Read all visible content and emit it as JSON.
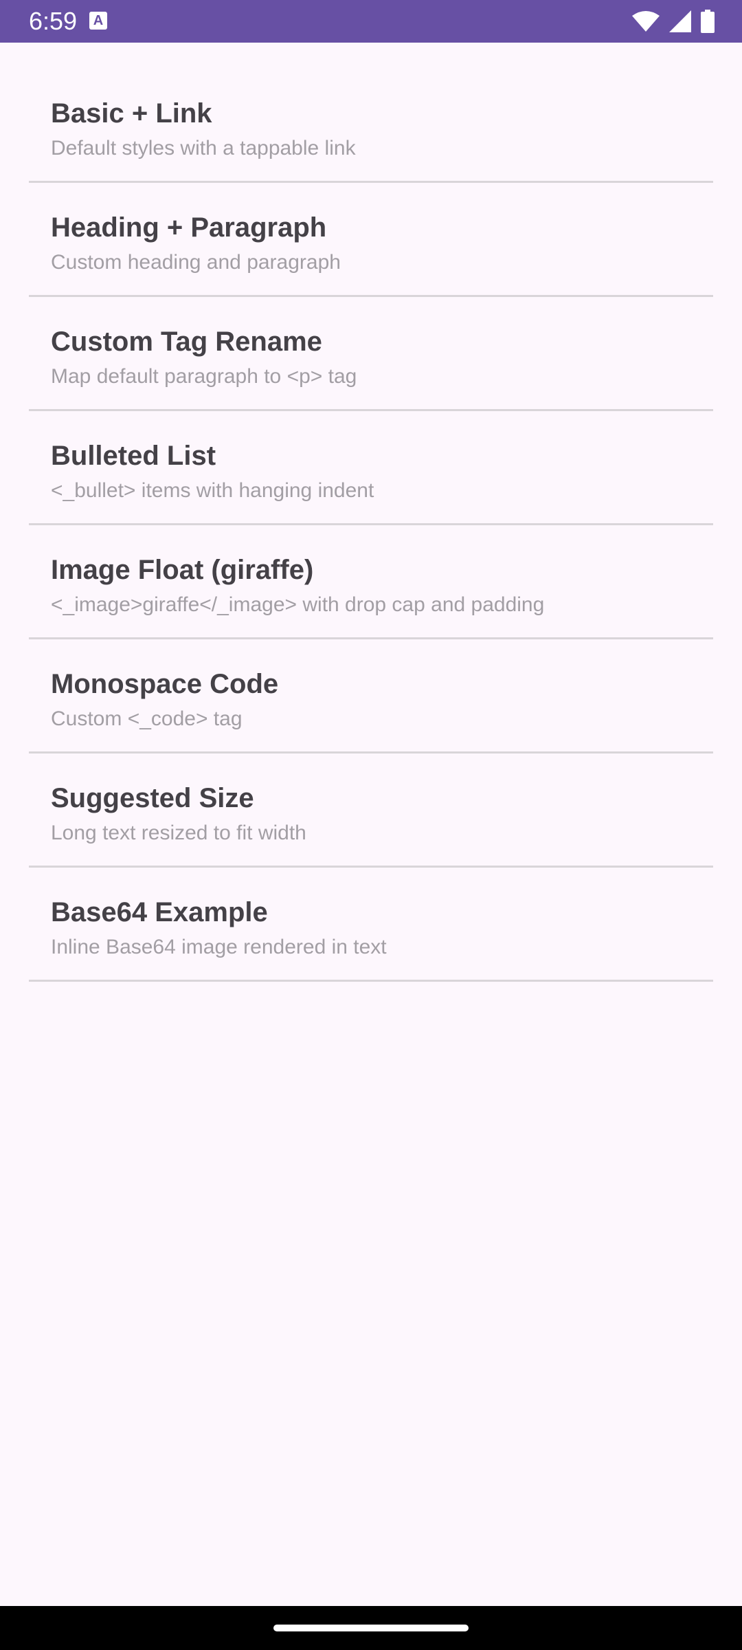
{
  "status_bar": {
    "time": "6:59",
    "notification_icon": "app-notification-icon",
    "icons": [
      "wifi-icon",
      "cellular-signal-icon",
      "battery-icon"
    ],
    "background": "#6750a4"
  },
  "list": {
    "items": [
      {
        "title": "Basic + Link",
        "subtitle": "Default styles with a tappable link"
      },
      {
        "title": "Heading + Paragraph",
        "subtitle": "Custom heading and paragraph"
      },
      {
        "title": "Custom Tag Rename",
        "subtitle": "Map default paragraph to <p> tag"
      },
      {
        "title": "Bulleted List",
        "subtitle": "<_bullet> items with hanging indent"
      },
      {
        "title": "Image Float (giraffe)",
        "subtitle": "<_image>giraffe</_image> with drop cap and padding"
      },
      {
        "title": "Monospace Code",
        "subtitle": "Custom <_code> tag"
      },
      {
        "title": "Suggested Size",
        "subtitle": "Long text resized to fit width"
      },
      {
        "title": "Base64 Example",
        "subtitle": "Inline Base64 image rendered in text"
      }
    ]
  },
  "colors": {
    "background": "#fdf7fd",
    "title_text": "#444147",
    "subtitle_text": "#a29ea4",
    "divider": "#d9d5d9"
  }
}
